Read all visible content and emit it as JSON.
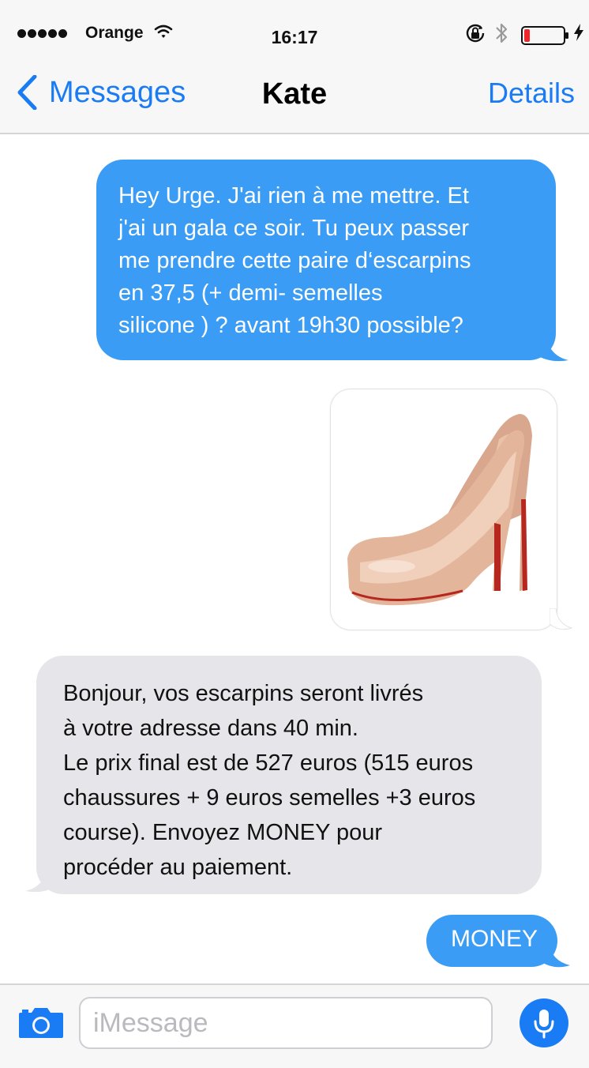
{
  "status_bar": {
    "carrier": "Orange",
    "time": "16:17",
    "signal_bars": 5,
    "battery_level": 0.15
  },
  "nav": {
    "back_label": "Messages",
    "title": "Kate",
    "details_label": "Details"
  },
  "messages": [
    {
      "direction": "outgoing",
      "lines": [
        "Hey Urge. J'ai rien à me mettre. Et",
        "j'ai un gala ce soir. Tu peux passer",
        "me prendre cette paire d‘escarpins",
        "en 37,5 (+ demi- semelles",
        "silicone ) ? avant 19h30 possible?"
      ]
    },
    {
      "direction": "outgoing",
      "type": "image",
      "icon": "nude-pumps-image"
    },
    {
      "direction": "incoming",
      "lines": [
        "Bonjour, vos escarpins seront livrés",
        "à votre adresse dans 40 min.",
        "Le prix final est de 527 euros (515 euros",
        "chaussures + 9 euros semelles +3 euros",
        "course). Envoyez MONEY pour",
        "procéder au paiement."
      ]
    },
    {
      "direction": "outgoing",
      "text": "MONEY"
    }
  ],
  "composer": {
    "placeholder": "iMessage"
  },
  "colors": {
    "accent": "#1a7cf5",
    "outgoing_bubble": "#3a9cf4",
    "incoming_bubble": "#e6e6ea"
  }
}
